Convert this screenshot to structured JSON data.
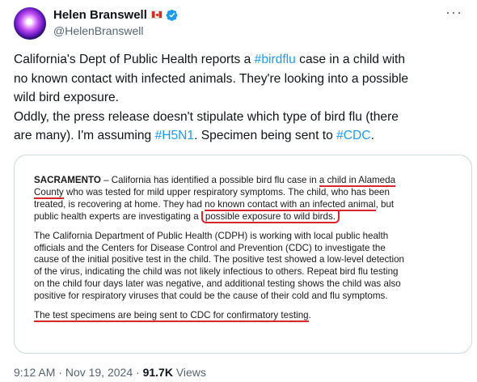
{
  "author": {
    "name": "Helen Branswell",
    "handle": "@HelenBranswell",
    "flag": "canada-flag",
    "verified_badge": "verified-badge-icon",
    "more_label": "···"
  },
  "tweet": {
    "line1_pre": "California's Dept of Public Health reports a ",
    "line1_tag": "#birdflu",
    "line1_post": " case in a child with",
    "line2": "no known contact with infected animals. They're looking into a possible",
    "line3": "wild bird exposure.",
    "line4": "Oddly, the press release doesn't stipulate which type of bird flu (there",
    "line5_pre": "are many). I'm assuming ",
    "line5_tag1": "#H5N1",
    "line5_mid": ". Specimen being sent to ",
    "line5_tag2": "#CDC",
    "line5_post": "."
  },
  "document": {
    "p1_city": "SACRAMENTO",
    "p1_l1_pre": " – California has identified a possible bird flu case in ",
    "p1_l1_hl": "a child in Alameda",
    "p1_l2_hl": "County",
    "p1_l2_post": " who was tested for mild upper respiratory symptoms. The child, who has been",
    "p1_l3_pre": "treated, is recovering at home. They had ",
    "p1_l3_hl": "no known contact with an infected animal",
    "p1_l3_post": ", but",
    "p1_l4_pre": "public health experts are investigating a ",
    "p1_l4_hl": "possible exposure to wild birds.",
    "p2_l1": "The California Department of Public Health (CDPH) is working with local public health",
    "p2_l2": "officials and the Centers for Disease Control and Prevention (CDC) to investigate the",
    "p2_l3": "cause of the initial positive test in the child. The positive test showed a low-level detection",
    "p2_l4": "of the virus, indicating the child was not likely infectious to others. Repeat bird flu testing",
    "p2_l5": "on the child four days later was negative, and additional testing shows the child was also",
    "p2_l6": "positive for respiratory viruses that could be the cause of their cold and flu symptoms.",
    "p3_hl": "The test specimens are being sent to CDC for confirmatory testing",
    "p3_post": "."
  },
  "meta": {
    "time": "9:12 AM",
    "sep1": " · ",
    "date": "Nov 19, 2024",
    "sep2": " · ",
    "views_count": "91.7K",
    "views_label": " Views"
  },
  "colors": {
    "link": "#1d9bf0",
    "highlight": "#d8262b",
    "verified": "#1d9bf0"
  }
}
